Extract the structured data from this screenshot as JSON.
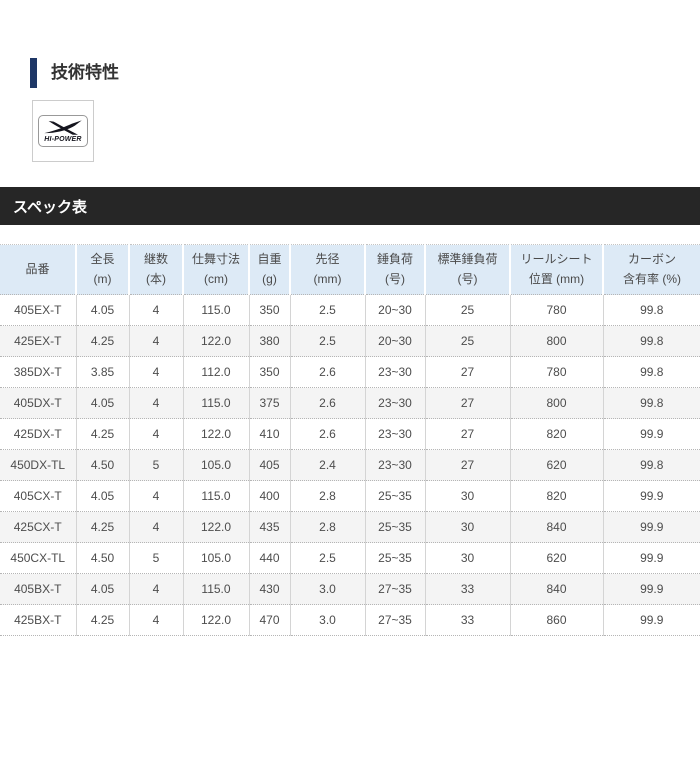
{
  "tech_section": {
    "title": "技術特性",
    "badge": {
      "icon": "hi-power-x-icon",
      "label": "HI-POWER"
    }
  },
  "spec_section": {
    "title": "スペック表"
  },
  "spec_table": {
    "column_headers": [
      [
        "品番"
      ],
      [
        "全長",
        "(m)"
      ],
      [
        "継数",
        "(本)"
      ],
      [
        "仕舞寸法",
        "(cm)"
      ],
      [
        "自重",
        "(g)"
      ],
      [
        "先径",
        "(mm)"
      ],
      [
        "錘負荷",
        "(号)"
      ],
      [
        "標準錘負荷",
        "(号)"
      ],
      [
        "リールシート",
        "位置 (mm)"
      ],
      [
        "カーボン",
        "含有率 (%)"
      ]
    ],
    "rows": [
      [
        "405EX-T",
        "4.05",
        "4",
        "115.0",
        "350",
        "2.5",
        "20~30",
        "25",
        "780",
        "99.8"
      ],
      [
        "425EX-T",
        "4.25",
        "4",
        "122.0",
        "380",
        "2.5",
        "20~30",
        "25",
        "800",
        "99.8"
      ],
      [
        "385DX-T",
        "3.85",
        "4",
        "112.0",
        "350",
        "2.6",
        "23~30",
        "27",
        "780",
        "99.8"
      ],
      [
        "405DX-T",
        "4.05",
        "4",
        "115.0",
        "375",
        "2.6",
        "23~30",
        "27",
        "800",
        "99.8"
      ],
      [
        "425DX-T",
        "4.25",
        "4",
        "122.0",
        "410",
        "2.6",
        "23~30",
        "27",
        "820",
        "99.9"
      ],
      [
        "450DX-TL",
        "4.50",
        "5",
        "105.0",
        "405",
        "2.4",
        "23~30",
        "27",
        "620",
        "99.8"
      ],
      [
        "405CX-T",
        "4.05",
        "4",
        "115.0",
        "400",
        "2.8",
        "25~35",
        "30",
        "820",
        "99.9"
      ],
      [
        "425CX-T",
        "4.25",
        "4",
        "122.0",
        "435",
        "2.8",
        "25~35",
        "30",
        "840",
        "99.9"
      ],
      [
        "450CX-TL",
        "4.50",
        "5",
        "105.0",
        "440",
        "2.5",
        "25~35",
        "30",
        "620",
        "99.9"
      ],
      [
        "405BX-T",
        "4.05",
        "4",
        "115.0",
        "430",
        "3.0",
        "27~35",
        "33",
        "840",
        "99.9"
      ],
      [
        "425BX-T",
        "4.25",
        "4",
        "122.0",
        "470",
        "3.0",
        "27~35",
        "33",
        "860",
        "99.9"
      ]
    ]
  },
  "colors": {
    "accent_navy": "#1e3766",
    "spec_bar_bg": "#262626",
    "spec_bar_text": "#ffffff",
    "table_header_bg": "#ddeaf6",
    "row_alt_bg": "#f4f4f4",
    "cell_text": "#4d4d4d",
    "logo_color": "#15151e"
  }
}
